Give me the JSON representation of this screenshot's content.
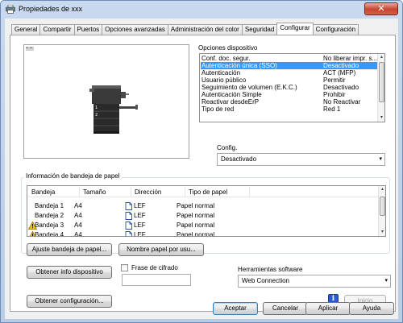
{
  "window": {
    "title": "Propiedades de xxx",
    "close_glyph": "✕"
  },
  "tabs": [
    "General",
    "Compartir",
    "Puertos",
    "Opciones avanzadas",
    "Administración del color",
    "Seguridad",
    "Configurar",
    "Configuración"
  ],
  "active_tab": "Configurar",
  "device_options": {
    "label": "Opciones dispositivo",
    "rows": [
      {
        "name": "Conf. doc. segur.",
        "value": "No liberar impr. s...",
        "selected": false
      },
      {
        "name": "Autenticación única (SSO)",
        "value": "Desactivado",
        "selected": true
      },
      {
        "name": "Autenticación",
        "value": "ACT (MFP)",
        "selected": false
      },
      {
        "name": "Usuario público",
        "value": "Permitir",
        "selected": false
      },
      {
        "name": "Seguimiento de volumen (E.K.C.)",
        "value": "Desactivado",
        "selected": false
      },
      {
        "name": "Autenticación Simple",
        "value": "Prohibir",
        "selected": false
      },
      {
        "name": "Reactivar desdeErP",
        "value": "No Reactivar",
        "selected": false
      },
      {
        "name": "Tipo de red",
        "value": "Red 1",
        "selected": false
      }
    ],
    "config_label": "Config.",
    "config_value": "Desactivado"
  },
  "tray_info": {
    "label": "Información de bandeja de papel",
    "columns": [
      "Bandeja",
      "Tamaño",
      "Dirección",
      "Tipo de papel"
    ],
    "rows": [
      {
        "tray": "Bandeja 1",
        "size": "A4",
        "direction": "LEF",
        "type": "Papel normal",
        "warning": false
      },
      {
        "tray": "Bandeja 2",
        "size": "A4",
        "direction": "LEF",
        "type": "Papel normal",
        "warning": false
      },
      {
        "tray": "Bandeja 3",
        "size": "A4",
        "direction": "LEF",
        "type": "Papel normal",
        "warning": true
      },
      {
        "tray": "Bandeja 4",
        "size": "A4",
        "direction": "LEF",
        "type": "Papel normal",
        "warning": true
      }
    ],
    "btn_adjust": "Ajuste bandeja de papel...",
    "btn_user_paper": "Nombre papel por usu..."
  },
  "lower": {
    "btn_get_info": "Obtener info dispositivo",
    "encryption_label": "Frase de cifrado",
    "software_label": "Herramientas software",
    "software_value": "Web Connection",
    "btn_get_config": "Obtener configuración...",
    "info_glyph": "i",
    "btn_start": "Inicio"
  },
  "footer": {
    "ok": "Aceptar",
    "cancel": "Cancelar",
    "apply": "Aplicar",
    "help": "Ayuda"
  },
  "icons": {
    "dropdown": "▾",
    "scroll_up": "▴",
    "scroll_down": "▾"
  },
  "colors": {
    "selection": "#3399ff",
    "info_icon": "#2b58d8",
    "warning": "#f5c400"
  }
}
